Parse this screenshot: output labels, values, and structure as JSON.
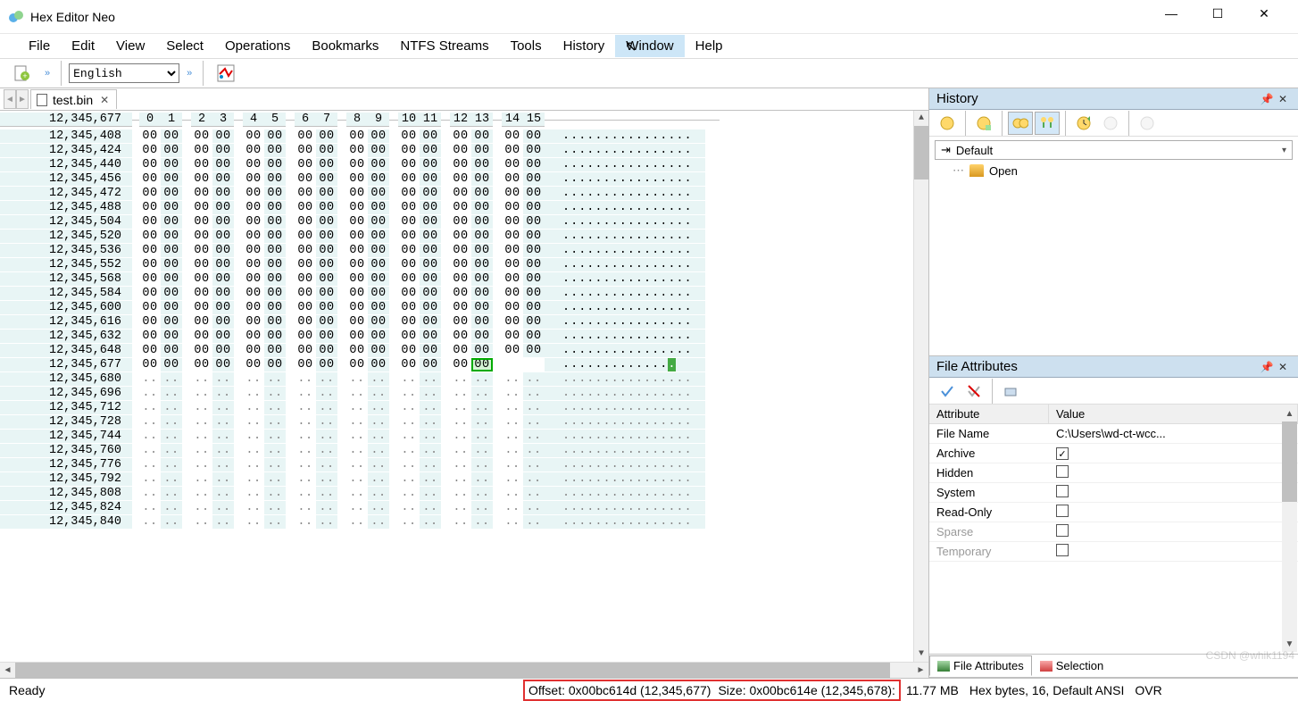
{
  "app": {
    "title": "Hex Editor Neo"
  },
  "menu": {
    "items": [
      "File",
      "Edit",
      "View",
      "Select",
      "Operations",
      "Bookmarks",
      "NTFS Streams",
      "Tools",
      "History",
      "Window",
      "Help"
    ],
    "active": "Window"
  },
  "toolbar": {
    "language": "English"
  },
  "tab": {
    "filename": "test.bin"
  },
  "hex": {
    "header_offset": "12,345,677",
    "columns": [
      "0",
      "1",
      "2",
      "3",
      "4",
      "5",
      "6",
      "7",
      "8",
      "9",
      "10",
      "11",
      "12",
      "13",
      "14",
      "15"
    ],
    "data_offsets": [
      "12,345,408",
      "12,345,424",
      "12,345,440",
      "12,345,456",
      "12,345,472",
      "12,345,488",
      "12,345,504",
      "12,345,520",
      "12,345,536",
      "12,345,552",
      "12,345,568",
      "12,345,584",
      "12,345,600",
      "12,345,616",
      "12,345,632",
      "12,345,648"
    ],
    "cursor_offset": "12,345,677",
    "cursor_row_bytes": 14,
    "empty_offsets": [
      "12,345,680",
      "12,345,696",
      "12,345,712",
      "12,345,728",
      "12,345,744",
      "12,345,760",
      "12,345,776",
      "12,345,792",
      "12,345,808",
      "12,345,824",
      "12,345,840"
    ],
    "zero_val": "00",
    "dot": "."
  },
  "history_panel": {
    "title": "History",
    "default_label": "Default",
    "tree": [
      {
        "label": "Open"
      }
    ]
  },
  "fattr_panel": {
    "title": "File Attributes",
    "cols": {
      "attr": "Attribute",
      "val": "Value"
    },
    "rows": [
      {
        "k": "File Name",
        "v": "C:\\Users\\wd-ct-wcc...",
        "type": "text"
      },
      {
        "k": "Archive",
        "type": "check",
        "checked": true
      },
      {
        "k": "Hidden",
        "type": "check",
        "checked": false
      },
      {
        "k": "System",
        "type": "check",
        "checked": false
      },
      {
        "k": "Read-Only",
        "type": "check",
        "checked": false
      },
      {
        "k": "Sparse",
        "type": "check",
        "checked": false,
        "dim": true
      },
      {
        "k": "Temporary",
        "type": "check",
        "checked": false,
        "dim": true
      }
    ],
    "tab1": "File Attributes",
    "tab2": "Selection"
  },
  "status": {
    "ready": "Ready",
    "offset": "Offset: 0x00bc614d (12,345,677)",
    "size": "Size: 0x00bc614e (12,345,678):",
    "filesize": "11.77 MB",
    "mode": "Hex bytes, 16, Default ANSI",
    "ovr": "OVR"
  },
  "watermark": "CSDN @whik1194"
}
